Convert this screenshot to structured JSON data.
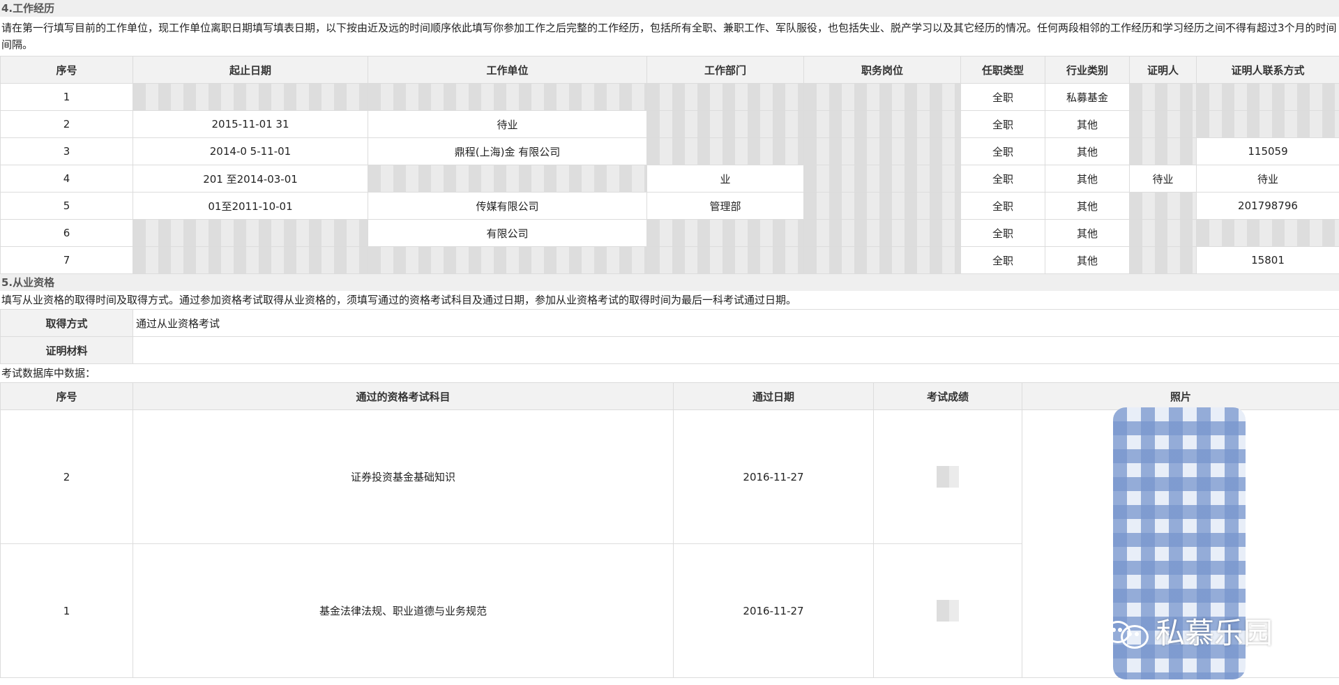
{
  "work_section": {
    "title": "4.工作经历",
    "description": "请在第一行填写目前的工作单位，现工作单位离职日期填写填表日期，以下按由近及远的时间顺序依此填写你参加工作之后完整的工作经历，包括所有全职、兼职工作、军队服役，也包括失业、脱产学习以及其它经历的情况。任何两段相邻的工作经历和学习经历之间不得有超过3个月的时间间隔。",
    "headers": [
      "序号",
      "起止日期",
      "工作单位",
      "工作部门",
      "职务岗位",
      "任职类型",
      "行业类别",
      "证明人",
      "证明人联系方式"
    ],
    "rows": [
      {
        "no": "1",
        "date": "",
        "employer": "",
        "dept": "",
        "position": "",
        "type": "全职",
        "industry": "私募基金",
        "witness": "",
        "contact": ""
      },
      {
        "no": "2",
        "date": "2015-11-01 31",
        "employer": "待业",
        "dept": "",
        "position": "",
        "type": "全职",
        "industry": "其他",
        "witness": "",
        "contact": ""
      },
      {
        "no": "3",
        "date": "2014-0 5-11-01",
        "employer": "鼎程(上海)金 有限公司",
        "dept": "",
        "position": "",
        "type": "全职",
        "industry": "其他",
        "witness": "",
        "contact": "115059"
      },
      {
        "no": "4",
        "date": "201 至2014-03-01",
        "employer": "",
        "dept": "业",
        "position": "",
        "type": "全职",
        "industry": "其他",
        "witness": "待业",
        "contact": "待业"
      },
      {
        "no": "5",
        "date": "01至2011-10-01",
        "employer": "传媒有限公司",
        "dept": "管理部",
        "position": "",
        "type": "全职",
        "industry": "其他",
        "witness": "",
        "contact": "201798796"
      },
      {
        "no": "6",
        "date": "",
        "employer": "有限公司",
        "dept": "",
        "position": "",
        "type": "全职",
        "industry": "其他",
        "witness": "",
        "contact": ""
      },
      {
        "no": "7",
        "date": "",
        "employer": "",
        "dept": "",
        "position": "",
        "type": "全职",
        "industry": "其他",
        "witness": "",
        "contact": "15801"
      }
    ]
  },
  "qual_section": {
    "title": "5.从业资格",
    "description": "填写从业资格的取得时间及取得方式。通过参加资格考试取得从业资格的，须填写通过的资格考试科目及通过日期，参加从业资格考试的取得时间为最后一科考试通过日期。",
    "method_label": "取得方式",
    "method_value": "通过从业资格考试",
    "material_label": "证明材料",
    "material_value": ""
  },
  "exam_section": {
    "caption": "考试数据库中数据：",
    "headers": [
      "序号",
      "通过的资格考试科目",
      "通过日期",
      "考试成绩",
      "照片"
    ],
    "rows": [
      {
        "no": "2",
        "subject": "证券投资基金基础知识",
        "date": "2016-11-27"
      },
      {
        "no": "1",
        "subject": "基金法律法规、职业道德与业务规范",
        "date": "2016-11-27"
      }
    ]
  },
  "watermark": {
    "text": "私慕乐园"
  }
}
